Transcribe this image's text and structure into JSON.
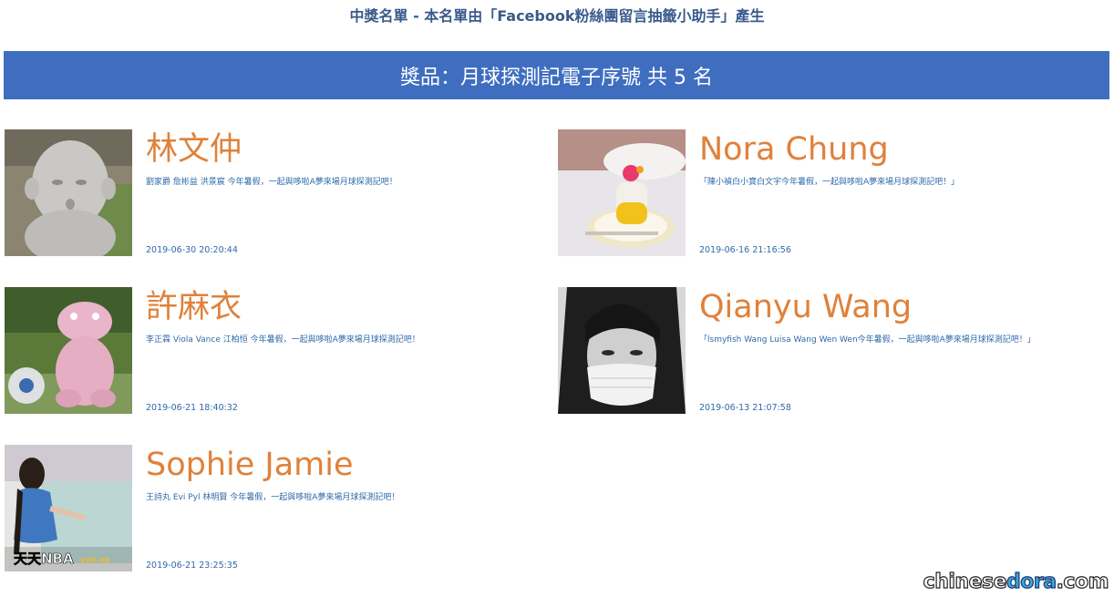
{
  "header": {
    "title": "中獎名單 - 本名單由「Facebook粉絲團留言抽籤小助手」產生"
  },
  "prize": {
    "label": "獎品：",
    "name": "月球探測記電子序號",
    "count_text": "共 5 名"
  },
  "winners": [
    {
      "name": "林文仲",
      "comment": "劉家爵 詹彬益 洪景宸 今年暑假，一起與哆啦A夢來場月球探測記吧！",
      "date": "2019-06-30 20:20:44",
      "photo_icon": "stone-statue-photo"
    },
    {
      "name": "Nora Chung",
      "comment": "「陳小禎白小寶白文宇今年暑假，一起與哆啦A夢來場月球探測記吧！」",
      "date": "2019-06-16 21:16:56",
      "photo_icon": "dessert-photo"
    },
    {
      "name": "許麻衣",
      "comment": "李正霖 Viola Vance 江柏恒 今年暑假，一起與哆啦A夢來場月球探測記吧！",
      "date": "2019-06-21 18:40:32",
      "photo_icon": "pink-dinosaur-photo"
    },
    {
      "name": "Qianyu Wang",
      "comment": "「lsmyfish Wang Luisa Wang Wen Wen今年暑假，一起與哆啦A夢來場月球探測記吧！」",
      "date": "2019-06-13 21:07:58",
      "photo_icon": "masked-person-photo"
    },
    {
      "name": "Sophie Jamie",
      "comment": "王詩丸 Evi Pyl 林明賢 今年暑假，一起與哆啦A夢來場月球探測記吧！",
      "date": "2019-06-21 23:25:35",
      "photo_icon": "painting-person-photo",
      "photo_overlay_text": "天天NBA",
      "photo_overlay_badge": "ELTA HD"
    }
  ],
  "watermark": {
    "part1": "chinese",
    "part2": "dora",
    "part3": ".com"
  },
  "colors": {
    "prize_bar": "#3f6ec0",
    "name": "#e0813a",
    "detail_text": "#2e6aa8",
    "title": "#3a5a8c"
  }
}
